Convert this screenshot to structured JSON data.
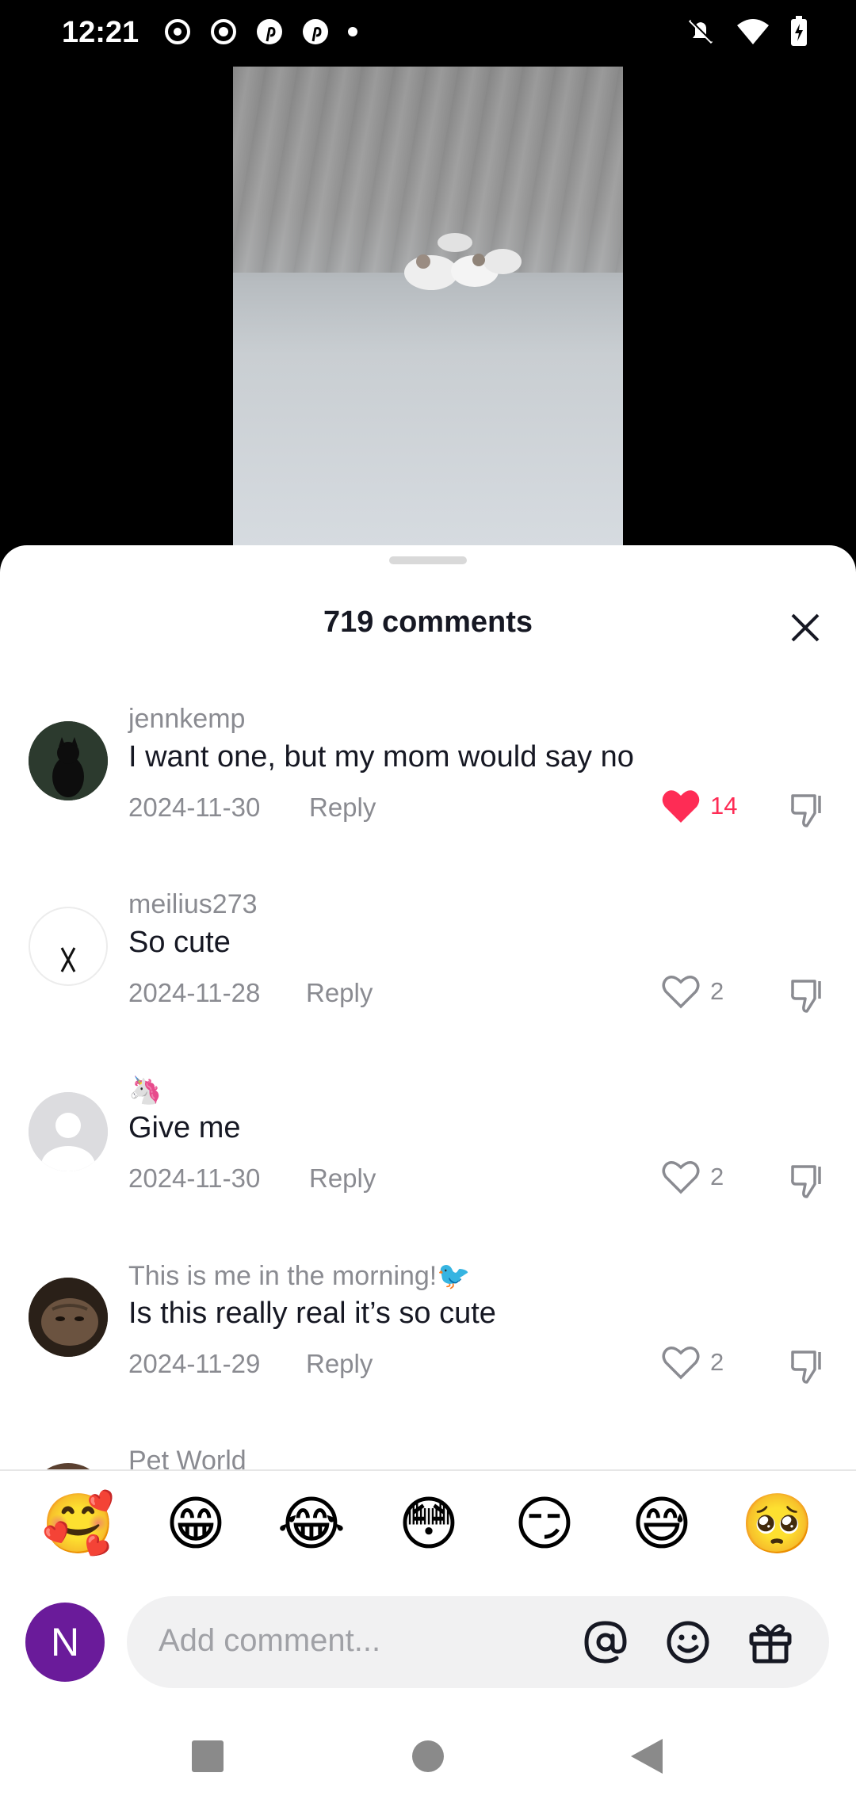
{
  "status_bar": {
    "time": "12:21"
  },
  "comments_sheet": {
    "title": "719 comments",
    "comments": [
      {
        "username": "jennkemp",
        "text": "I want one, but my mom would say no",
        "date": "2024-11-30",
        "reply_label": "Reply",
        "likes": "14",
        "liked": true
      },
      {
        "username": "meilius273",
        "text": "So cute",
        "date": "2024-11-28",
        "reply_label": "Reply",
        "likes": "2",
        "liked": false
      },
      {
        "username": "🦄",
        "text": "Give me",
        "date": "2024-11-30",
        "reply_label": "Reply",
        "likes": "2",
        "liked": false
      },
      {
        "username": "This is me in the morning!🐦",
        "text": "Is this really real it’s so cute",
        "date": "2024-11-29",
        "reply_label": "Reply",
        "likes": "2",
        "liked": false
      },
      {
        "username": "Pet World"
      }
    ],
    "emoji_bar": [
      "🥰",
      "😁",
      "😂",
      "😳",
      "😏",
      "😅",
      "🥺"
    ],
    "composer": {
      "avatar_letter": "N",
      "placeholder": "Add comment..."
    }
  },
  "colors": {
    "like_active": "#fe2c55",
    "avatar_bg": "#6a1b9a"
  }
}
